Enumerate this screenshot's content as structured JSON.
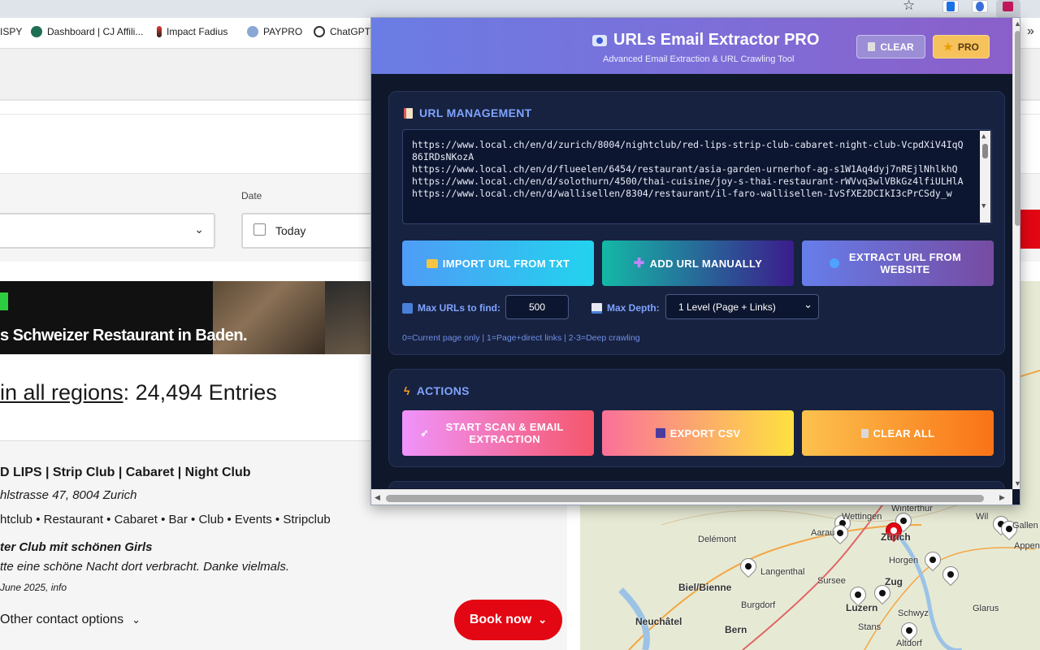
{
  "browser": {
    "bookmarks": [
      "ISPY",
      "Dashboard | CJ Affili...",
      "Impact Fadius",
      "PAYPRO",
      "ChatGPT"
    ],
    "overflow_icon": "chevron-double-right-icon"
  },
  "page": {
    "date_label": "Date",
    "date_value": "Today",
    "banner_text": "s Schweizer Restaurant in Baden.",
    "entries_link": "in all regions",
    "entries_rest": ": 24,494 Entries",
    "listing": {
      "title": "D LIPS | Strip Club | Cabaret | Night Club",
      "address": "hlstrasse 47, 8004 Zurich",
      "categories": "htclub • Restaurant • Cabaret • Bar • Club • Events • Stripclub",
      "review_title": "ter Club mit schönen Girls",
      "review_text": "tte eine schöne Nacht dort verbracht. Danke vielmals.",
      "review_meta": "June 2025, info",
      "contact": "Other contact options",
      "book": "Book now"
    },
    "map_cities": [
      "Winterthur",
      "Wettingen",
      "Wil",
      "Gallen",
      "Delémont",
      "Aarau",
      "Zürich",
      "Appenzell",
      "Horgen",
      "Langenthal",
      "Sursee",
      "Zug",
      "Biel/Bienne",
      "Luzern",
      "Burgdorf",
      "Glarus",
      "Schwyz",
      "Neuchâtel",
      "Stans",
      "Bern",
      "Altdorf"
    ]
  },
  "popup": {
    "title": "URLs Email Extractor PRO",
    "subtitle": "Advanced Email Extraction & URL Crawling Tool",
    "clear_btn": "CLEAR",
    "pro_btn": "PRO",
    "url_section": {
      "title": "URL MANAGEMENT",
      "urls": [
        "https://www.local.ch/en/d/zurich/8004/nightclub/red-lips-strip-club-cabaret-night-club-VcpdXiV4IqQ86IRDsNKozA",
        "https://www.local.ch/en/d/flueelen/6454/restaurant/asia-garden-urnerhof-ag-s1W1Aq4dyj7nREjlNhlkhQ",
        "https://www.local.ch/en/d/solothurn/4500/thai-cuisine/joy-s-thai-restaurant-rWVvq3wlVBkGz4lfiULHlA",
        "https://www.local.ch/en/d/wallisellen/8304/restaurant/il-faro-wallisellen-IvSfXE2DCIkI3cPrCSdy_w"
      ],
      "import_btn": "IMPORT URL FROM TXT",
      "add_btn": "ADD URL MANUALLY",
      "extract_btn": "EXTRACT URL FROM WEBSITE",
      "max_urls_label": "Max URLs to find:",
      "max_urls_value": "500",
      "max_depth_label": "Max Depth:",
      "max_depth_value": "1 Level (Page + Links)",
      "hint": "0=Current page only | 1=Page+direct links | 2-3=Deep crawling"
    },
    "actions": {
      "title": "ACTIONS",
      "start_btn": "START SCAN & EMAIL EXTRACTION",
      "export_btn": "EXPORT CSV",
      "clear_all_btn": "CLEAR ALL"
    }
  }
}
